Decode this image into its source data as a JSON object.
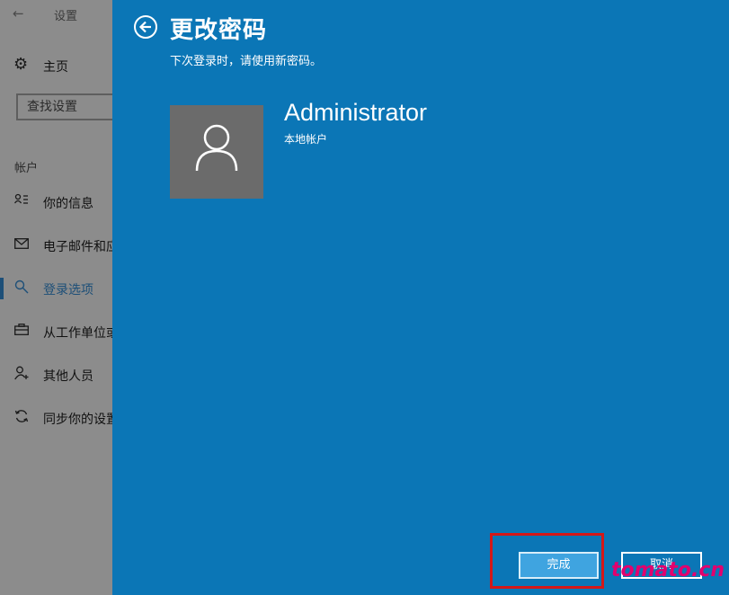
{
  "settings": {
    "app_title": "设置",
    "home_label": "主页",
    "search_placeholder": "查找设置",
    "section_label": "帐户",
    "nav_items": [
      {
        "label": "你的信息",
        "icon": "person-card-icon"
      },
      {
        "label": "电子邮件和应用帐户",
        "icon": "mail-icon"
      },
      {
        "label": "登录选项",
        "icon": "key-icon",
        "active": true
      },
      {
        "label": "从工作单位或学校访问",
        "icon": "briefcase-icon"
      },
      {
        "label": "其他人员",
        "icon": "person-add-icon"
      },
      {
        "label": "同步你的设置",
        "icon": "sync-icon"
      }
    ]
  },
  "dialog": {
    "title": "更改密码",
    "subtitle": "下次登录时，请使用新密码。",
    "user_name": "Administrator",
    "account_type": "本地帐户",
    "done_label": "完成",
    "cancel_label": "取消",
    "background_color": "#0b76b6"
  },
  "watermark": "tomato.cn"
}
